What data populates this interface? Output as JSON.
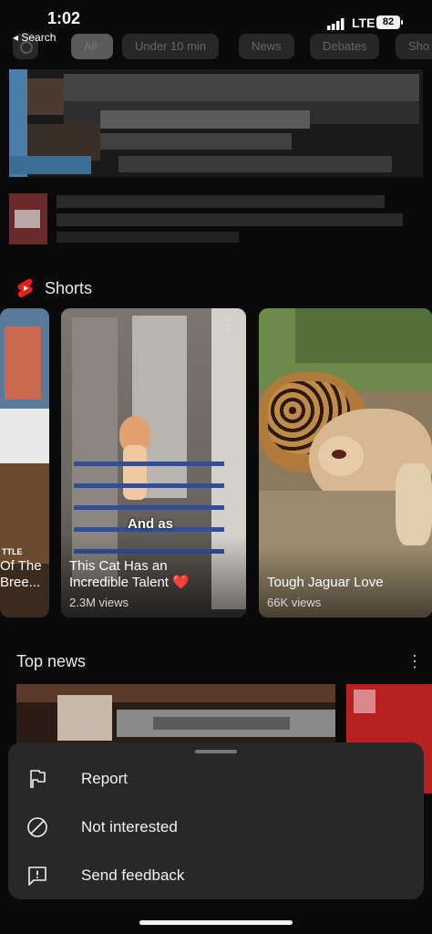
{
  "status_bar": {
    "time": "1:02",
    "back_label": "◂ Search",
    "network": "LTE",
    "battery": "82"
  },
  "chips": [
    "All",
    "Under 10 min",
    "News",
    "Debates",
    "Sho"
  ],
  "shorts": {
    "title": "Shorts",
    "items": [
      {
        "caption_line1": "Of The",
        "caption_line2": "Bree...",
        "views": "",
        "overlay": "TTLE"
      },
      {
        "caption_line1": "This Cat Has an",
        "caption_line2": "Incredible Talent ❤️",
        "views": "2.3M views",
        "overlay": "And as"
      },
      {
        "caption_line1": "Tough Jaguar Love",
        "caption_line2": "",
        "views": "66K views",
        "overlay": ""
      }
    ]
  },
  "top_news": {
    "title": "Top news",
    "more_icon": "more-vert-icon"
  },
  "sheet": {
    "items": [
      {
        "label": "Report",
        "icon": "flag-icon"
      },
      {
        "label": "Not interested",
        "icon": "block-icon"
      },
      {
        "label": "Send feedback",
        "icon": "feedback-icon"
      }
    ]
  },
  "colors": {
    "background": "#0a0a0a",
    "sheet": "#282828",
    "shorts_red": "#e62117"
  }
}
